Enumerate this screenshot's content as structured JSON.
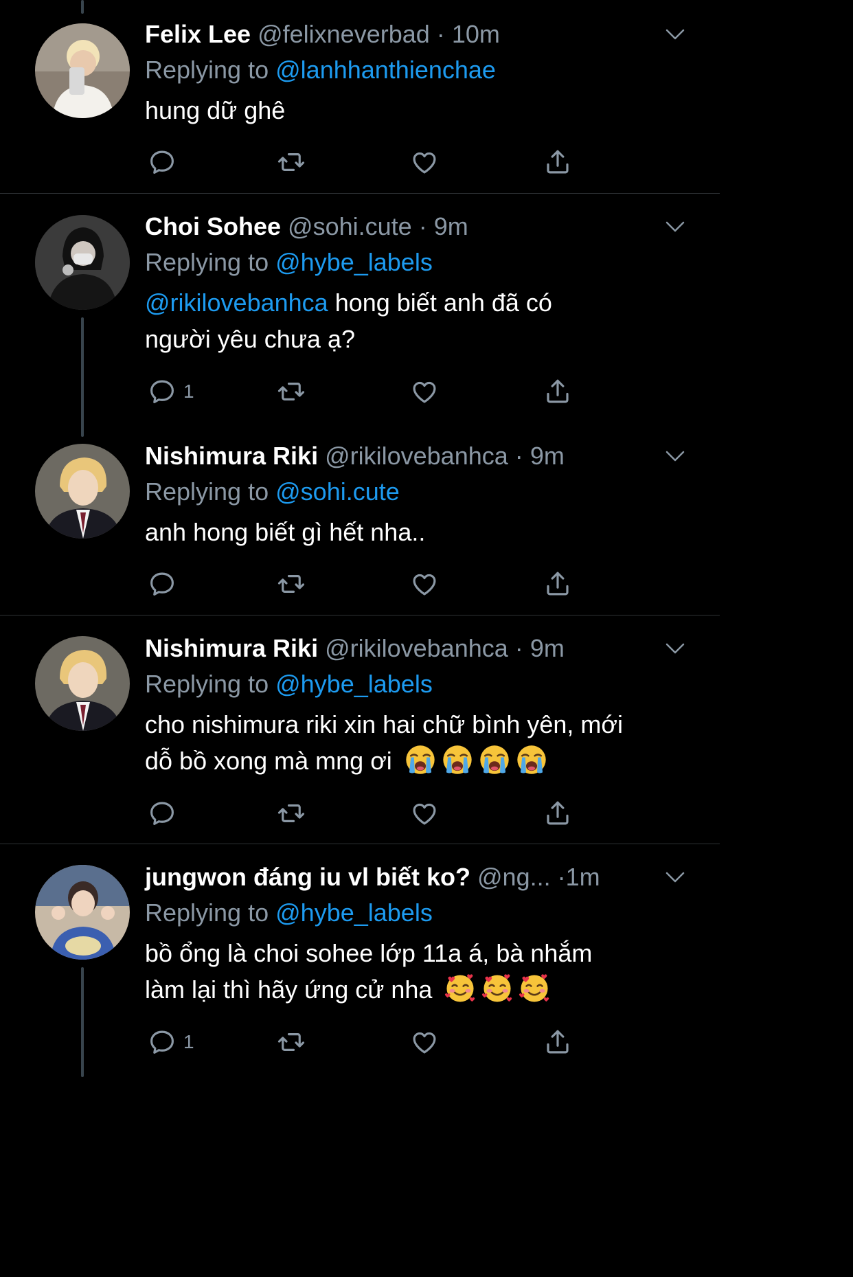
{
  "tweets": [
    {
      "name": "Felix Lee",
      "handle": "@felixneverbad",
      "dot": "·",
      "time": "10m",
      "reply_prefix": "Replying to",
      "reply_to": "@lanhhanthienchae",
      "text_mention": "",
      "text": "hung dữ ghê",
      "text_line2": "",
      "reply_count": ""
    },
    {
      "name": "Choi Sohee",
      "handle": "@sohi.cute",
      "dot": "·",
      "time": "9m",
      "reply_prefix": "Replying to",
      "reply_to": "@hybe_labels",
      "text_mention": "@rikilovebanhca",
      "text": " hong biết anh đã có",
      "text_line2": "người yêu chưa ạ?",
      "reply_count": "1"
    },
    {
      "name": "Nishimura Riki",
      "handle": "@rikilovebanhca",
      "dot": "·",
      "time": "9m",
      "reply_prefix": "Replying to",
      "reply_to": "@sohi.cute",
      "text_mention": "",
      "text": "anh hong biết gì hết nha..",
      "text_line2": "",
      "reply_count": ""
    },
    {
      "name": "Nishimura Riki",
      "handle": "@rikilovebanhca",
      "dot": "·",
      "time": "9m",
      "reply_prefix": "Replying to",
      "reply_to": "@hybe_labels",
      "text_mention": "",
      "text": "cho nishimura riki xin hai chữ bình yên, mới",
      "text_line2": "dỗ bồ xong mà mng ơi",
      "emoji": "loudly-crying-face",
      "emoji_count": 4,
      "reply_count": ""
    },
    {
      "name": "jungwon đáng iu vl biết ko?",
      "handle": "@ng...",
      "dot": "·",
      "time": "1m",
      "reply_prefix": "Replying to",
      "reply_to": "@hybe_labels",
      "text_mention": "",
      "text": "bồ ổng là choi sohee lớp 11a á, bà nhắm",
      "text_line2": "làm lại thì hãy ứng cử nha",
      "emoji": "smiling-face-with-hearts",
      "emoji_count": 3,
      "reply_count": "1"
    }
  ],
  "colors": {
    "background": "#000000",
    "text": "#ffffff",
    "secondary": "#8b98a5",
    "link": "#1d9bf0",
    "divider": "#2f3336",
    "thread_line": "#38444d"
  },
  "icons": [
    "reply-icon",
    "retweet-icon",
    "like-icon",
    "share-icon",
    "chevron-down-icon"
  ]
}
